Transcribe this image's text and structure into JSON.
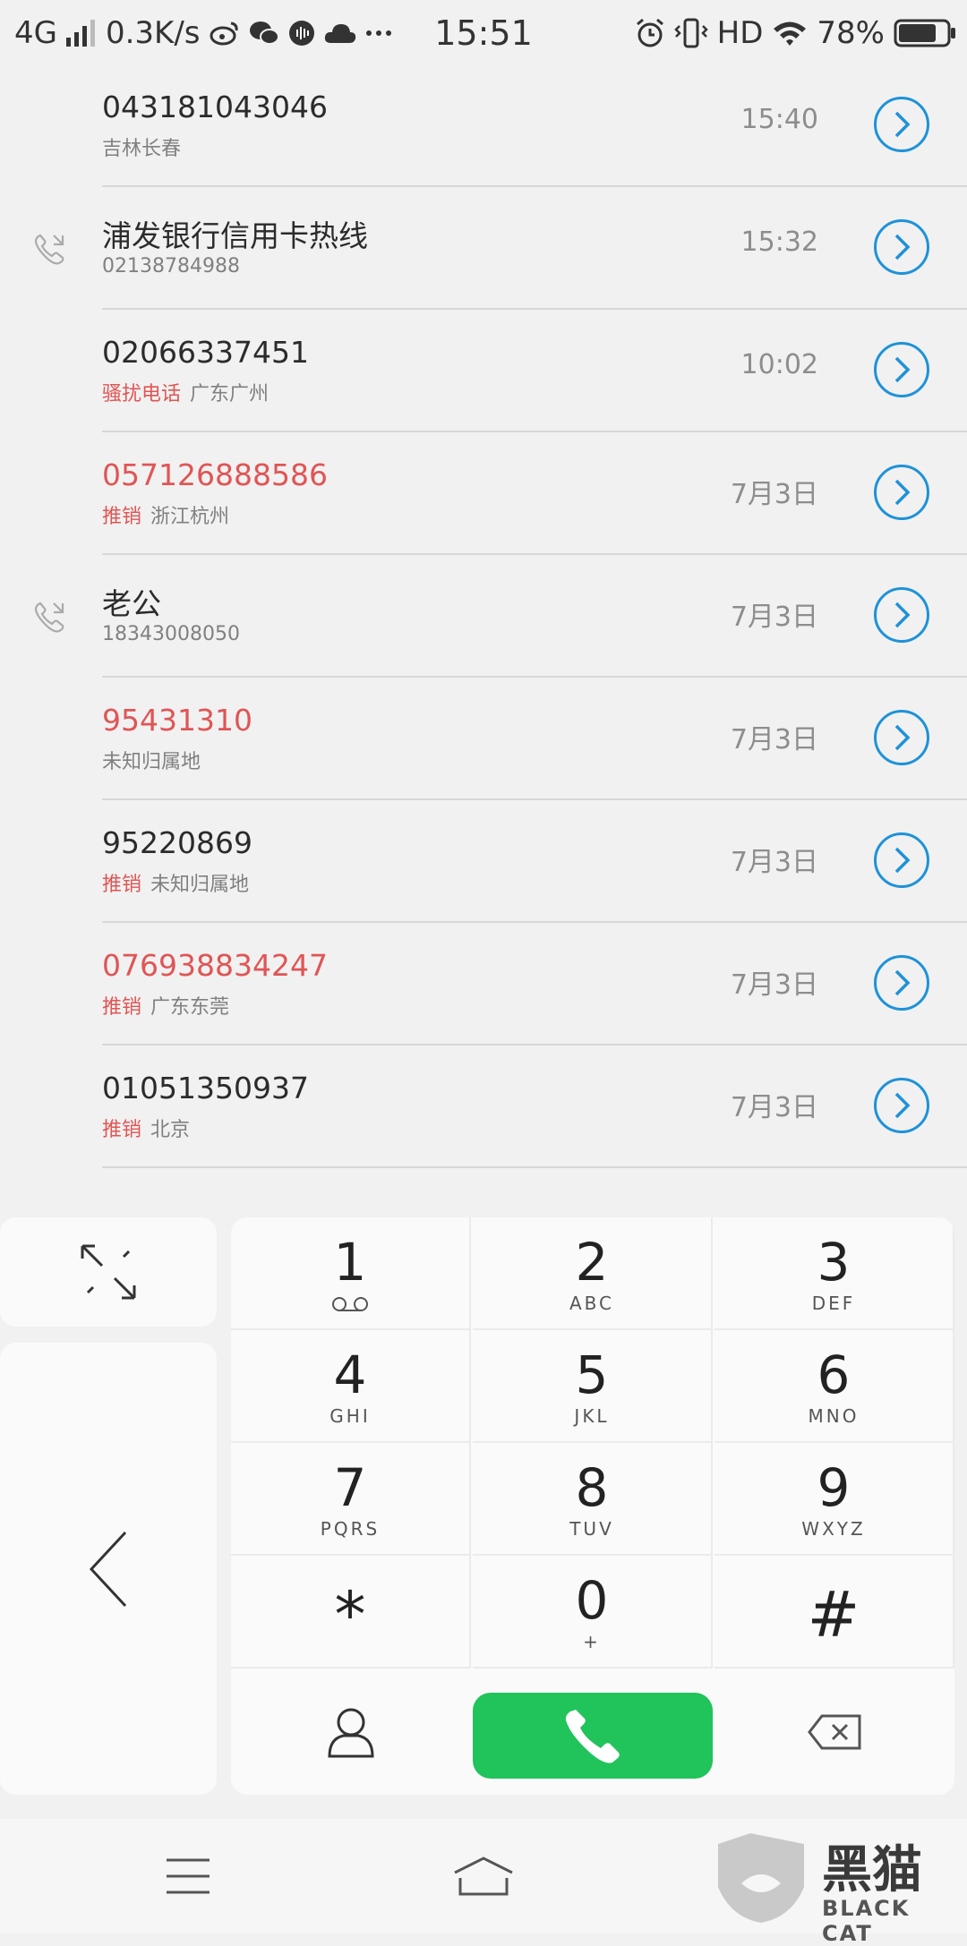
{
  "status_bar": {
    "network": "4G",
    "speed": "0.3K/s",
    "time": "15:51",
    "hd": "HD",
    "battery": "78%",
    "battery_level": 0.78
  },
  "call_log": [
    {
      "name": "043181043046",
      "sub": "吉林长春",
      "tag": "",
      "time": "15:40",
      "spam": false,
      "has_icon": false
    },
    {
      "name": "浦发银行信用卡热线",
      "sub": "02138784988",
      "tag": "",
      "time": "15:32",
      "spam": false,
      "has_icon": true
    },
    {
      "name": "02066337451",
      "sub": "广东广州",
      "tag": "骚扰电话",
      "time": "10:02",
      "spam": false,
      "has_icon": false
    },
    {
      "name": "057126888586",
      "sub": "浙江杭州",
      "tag": "推销",
      "time": "7月3日",
      "spam": true,
      "has_icon": false
    },
    {
      "name": "老公",
      "sub": "18343008050",
      "tag": "",
      "time": "7月3日",
      "spam": false,
      "has_icon": true
    },
    {
      "name": "95431310",
      "sub": "未知归属地",
      "tag": "",
      "time": "7月3日",
      "spam": true,
      "has_icon": false
    },
    {
      "name": "95220869",
      "sub": "未知归属地",
      "tag": "推销",
      "time": "7月3日",
      "spam": false,
      "has_icon": false
    },
    {
      "name": "076938834247",
      "sub": "广东东莞",
      "tag": "推销",
      "time": "7月3日",
      "spam": true,
      "has_icon": false
    },
    {
      "name": "01051350937",
      "sub": "北京",
      "tag": "推销",
      "time": "7月3日",
      "spam": false,
      "has_icon": false
    }
  ],
  "keypad": {
    "keys": [
      {
        "digit": "1",
        "letters": "voicemail"
      },
      {
        "digit": "2",
        "letters": "ABC"
      },
      {
        "digit": "3",
        "letters": "DEF"
      },
      {
        "digit": "4",
        "letters": "GHI"
      },
      {
        "digit": "5",
        "letters": "JKL"
      },
      {
        "digit": "6",
        "letters": "MNO"
      },
      {
        "digit": "7",
        "letters": "PQRS"
      },
      {
        "digit": "8",
        "letters": "TUV"
      },
      {
        "digit": "9",
        "letters": "WXYZ"
      },
      {
        "digit": "*",
        "letters": ""
      },
      {
        "digit": "0",
        "letters": "+"
      },
      {
        "digit": "#",
        "letters": ""
      }
    ]
  },
  "watermark": {
    "text": "黑猫",
    "sub": "BLACK CAT"
  },
  "colors": {
    "accent_blue": "#1e92d8",
    "spam_red": "#e05555",
    "call_green": "#21c35b"
  }
}
